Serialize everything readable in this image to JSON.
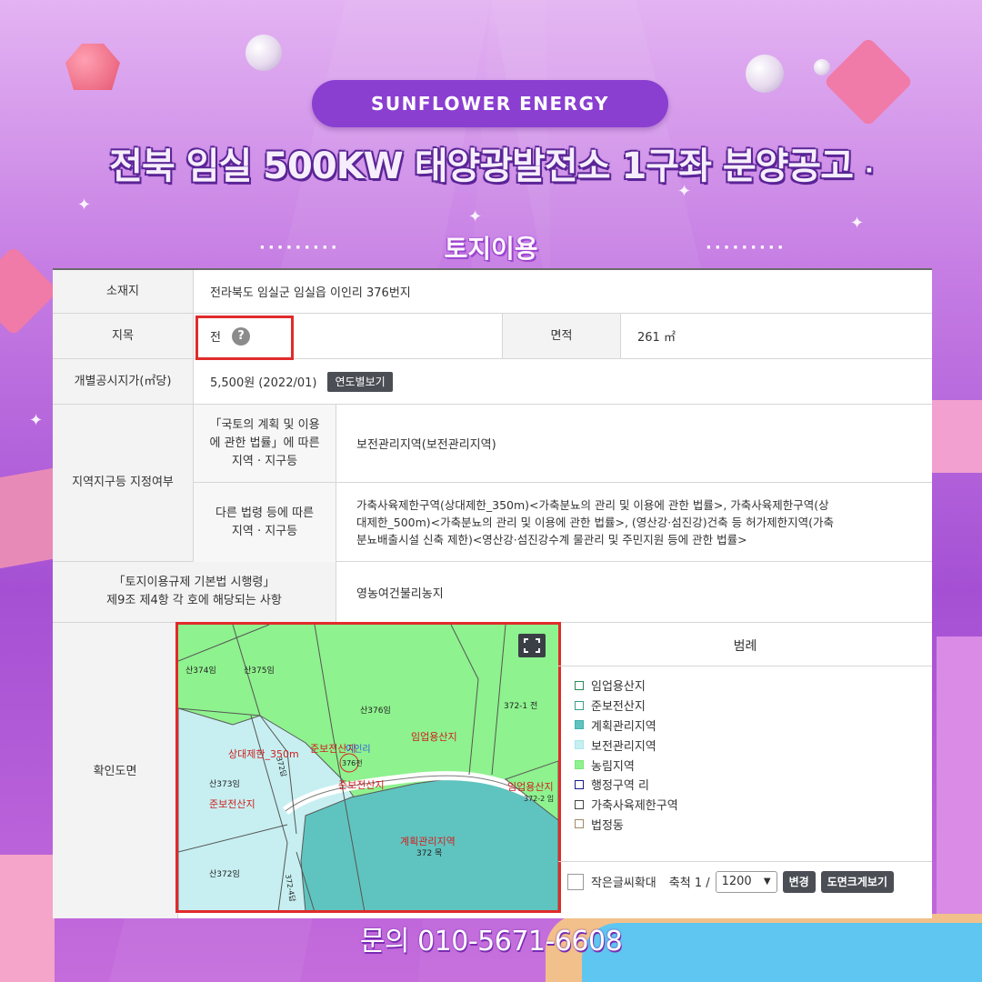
{
  "header": {
    "brand": "SUNFLOWER ENERGY",
    "headline": "전북 임실 500KW 태양광발전소 1구좌 분양공고",
    "headline_suffix": "·",
    "section_title": "토지이용",
    "dots_left": "·········",
    "dots_right": "·········"
  },
  "land": {
    "location_label": "소재지",
    "location_value": "전라북도 임실군 임실읍 이인리 376번지",
    "category_label": "지목",
    "category_value": "전",
    "category_help": "?",
    "area_label": "면적",
    "area_value": "261 ㎡",
    "price_label": "개별공시지가(㎡당)",
    "price_value": "5,500원 (2022/01)",
    "price_button": "연도별보기",
    "zone_label": "지역지구등 지정여부",
    "zone_sub1_label_l1": "「국토의 계획 및 이용",
    "zone_sub1_label_l2": "에 관한 법률」에 따른",
    "zone_sub1_label_l3": "지역 · 지구등",
    "zone_sub1_value": "보전관리지역(보전관리지역)",
    "zone_sub2_label_l1": "다른 법령 등에 따른",
    "zone_sub2_label_l2": "지역 · 지구등",
    "zone_sub2_value_l1": "가축사육제한구역(상대제한_350m)<가축분뇨의 관리 및 이용에 관한 법률>, 가축사육제한구역(상",
    "zone_sub2_value_l2": "대제한_500m)<가축분뇨의 관리 및 이용에 관한 법률>, (영산강·섬진강)건축 등 허가제한지역(가축",
    "zone_sub2_value_l3": "분뇨배출시설 신축 제한)<영산강·섬진강수계 물관리 및 주민지원 등에 관한 법률>",
    "reg_label_l1": "「토지이용규제 기본법 시행령」",
    "reg_label_l2": "제9조 제4항 각 호에 해당되는 사항",
    "reg_value": "영농여건불리농지",
    "map_label": "확인도면"
  },
  "map": {
    "labels": {
      "p374": "산374임",
      "p375": "산375임",
      "p376": "산376임",
      "p3721": "372-1 전",
      "forest1": "임업용산지",
      "semi1": "준보전산지",
      "limit": "상대제한_350m",
      "iinri": "이인리",
      "p376b": "376전",
      "semi2": "준보전산지",
      "p373": "산373임",
      "semi3": "준보전산지",
      "road": "372답",
      "forest2": "임업용산지",
      "p3722": "372-2 임",
      "plan": "계획관리지역",
      "p372": "372 목",
      "p372b": "산372임",
      "p3724": "372-4답"
    }
  },
  "legend": {
    "title": "범례",
    "items": [
      {
        "label": "임업용산지",
        "border": "#2b8a5a",
        "fill": "#ffffff"
      },
      {
        "label": "준보전산지",
        "border": "#3aa08a",
        "fill": "#ffffff"
      },
      {
        "label": "계획관리지역",
        "border": "#3eb3ad",
        "fill": "#5fc4bf"
      },
      {
        "label": "보전관리지역",
        "border": "#a9e7ea",
        "fill": "#c7eff1"
      },
      {
        "label": "농림지역",
        "border": "#7ee57e",
        "fill": "#8ef28e"
      },
      {
        "label": "행정구역 리",
        "border": "#1a1a8c",
        "fill": "#ffffff"
      },
      {
        "label": "가축사육제한구역",
        "border": "#444444",
        "fill": "#ffffff"
      },
      {
        "label": "법정동",
        "border": "#a08a6a",
        "fill": "#ffffff"
      }
    ],
    "enlarge_text": "작은글씨확대",
    "scale_label": "축척 1 /",
    "scale_value": "1200",
    "change_button": "변경",
    "big_map_button": "도면크게보기"
  },
  "footer": {
    "contact": "문의 010-5671-6608"
  },
  "colors": {
    "accent": "#8a3fd1",
    "highlight": "#e02b2b",
    "agri": "#8ef28e",
    "plan": "#5fc4bf",
    "conserve": "#c7eff1"
  }
}
